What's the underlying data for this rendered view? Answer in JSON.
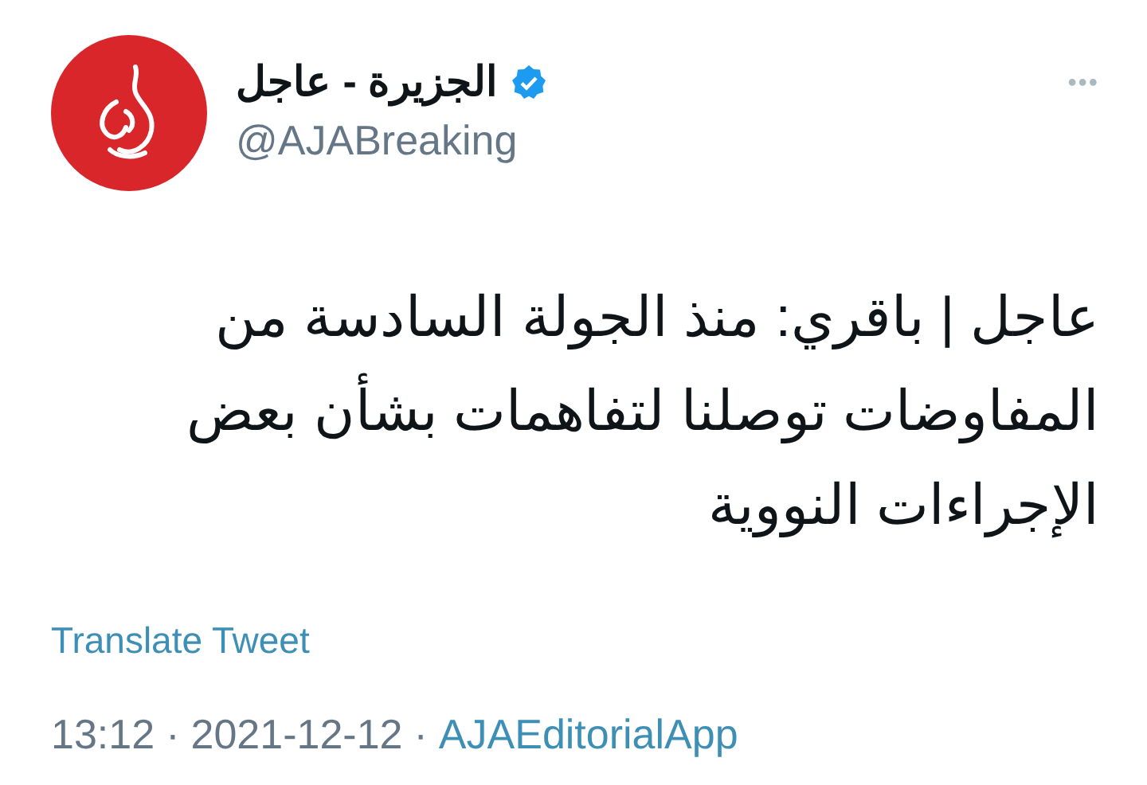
{
  "author": {
    "name": "الجزيرة - عاجل",
    "verified": true,
    "handle": "@AJABreaking"
  },
  "more_button": "•••",
  "text": "عاجل | باقري: منذ الجولة السادسة من\nالمفاوضات توصلنا لتفاهمات بشأن بعض\nالإجراءات النووية",
  "translate_link": "Translate Tweet",
  "meta": {
    "time": "13:12",
    "separator": "·",
    "date": "2021-12-12",
    "source": "AJAEditorialApp"
  }
}
